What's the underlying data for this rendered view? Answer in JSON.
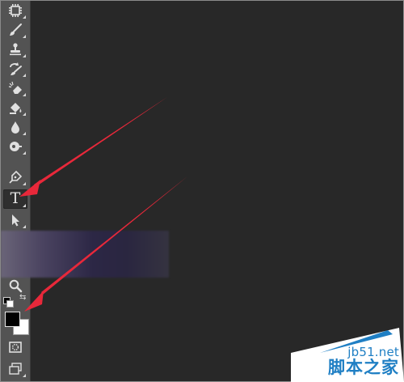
{
  "toolbar": {
    "tools": [
      {
        "id": "marquee-tool",
        "icon": "film-strip-icon"
      },
      {
        "id": "brush-tool",
        "icon": "brush-icon"
      },
      {
        "id": "clone-stamp-tool",
        "icon": "stamp-icon"
      },
      {
        "id": "history-brush-tool",
        "icon": "history-brush-icon"
      },
      {
        "id": "eraser-tool",
        "icon": "eraser-icon"
      },
      {
        "id": "paint-bucket-tool",
        "icon": "paint-bucket-icon"
      },
      {
        "id": "blur-tool",
        "icon": "drop-icon"
      },
      {
        "id": "dodge-tool",
        "icon": "dodge-icon"
      },
      {
        "id": "pen-tool",
        "icon": "pen-icon"
      },
      {
        "id": "type-tool",
        "icon": "type-icon",
        "glyph": "T",
        "active": true
      },
      {
        "id": "path-selection-tool",
        "icon": "arrow-icon"
      },
      {
        "id": "zoom-tool",
        "icon": "magnifier-icon"
      },
      {
        "id": "quick-mask",
        "icon": "quick-mask-icon"
      },
      {
        "id": "screen-mode",
        "icon": "screen-mode-icon"
      }
    ],
    "foreground_color": "#000000",
    "background_color": "#ffffff"
  },
  "colors": {
    "toolbar": "#535353",
    "canvas": "#282828",
    "arrow": "#e8283a",
    "watermark": "#1f7fc4"
  },
  "watermark": {
    "domain": "jb51.net",
    "name": "脚本之家"
  }
}
